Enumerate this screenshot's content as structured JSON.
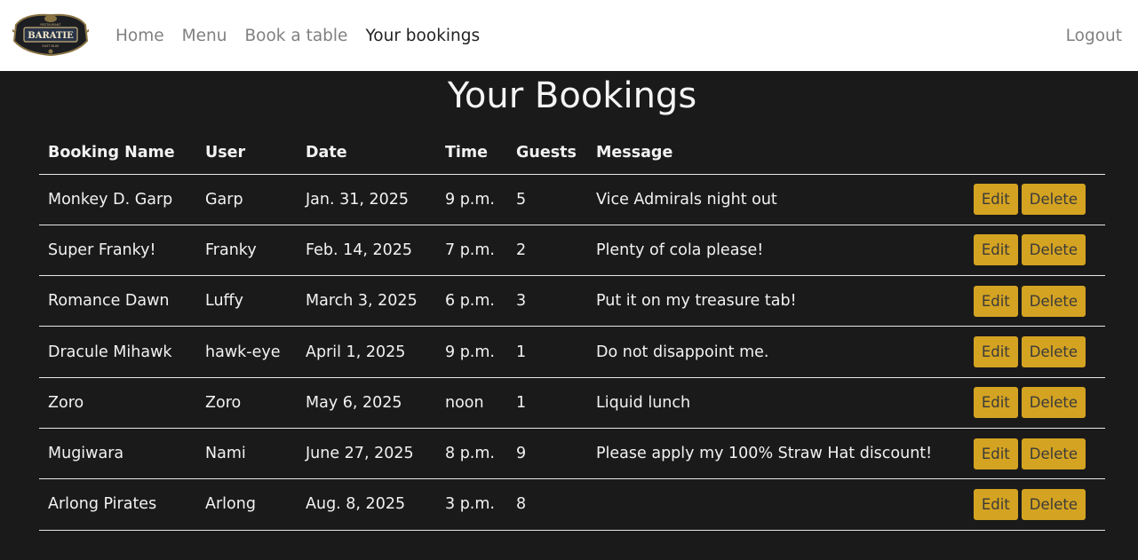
{
  "nav": {
    "items": [
      {
        "label": "Home",
        "active": false
      },
      {
        "label": "Menu",
        "active": false
      },
      {
        "label": "Book a table",
        "active": false
      },
      {
        "label": "Your bookings",
        "active": true
      }
    ],
    "logout_label": "Logout",
    "logo_icon": "baratie-logo-icon"
  },
  "page": {
    "title": "Your Bookings"
  },
  "table": {
    "columns": [
      "Booking Name",
      "User",
      "Date",
      "Time",
      "Guests",
      "Message",
      ""
    ],
    "rows": [
      {
        "name": "Monkey D. Garp",
        "user": "Garp",
        "date": "Jan. 31, 2025",
        "time": "9 p.m.",
        "guests": "5",
        "message": "Vice Admirals night out"
      },
      {
        "name": "Super Franky!",
        "user": "Franky",
        "date": "Feb. 14, 2025",
        "time": "7 p.m.",
        "guests": "2",
        "message": "Plenty of cola please!"
      },
      {
        "name": "Romance Dawn",
        "user": "Luffy",
        "date": "March 3, 2025",
        "time": "6 p.m.",
        "guests": "3",
        "message": "Put it on my treasure tab!"
      },
      {
        "name": "Dracule Mihawk",
        "user": "hawk-eye",
        "date": "April 1, 2025",
        "time": "9 p.m.",
        "guests": "1",
        "message": "Do not disappoint me."
      },
      {
        "name": "Zoro",
        "user": "Zoro",
        "date": "May 6, 2025",
        "time": "noon",
        "guests": "1",
        "message": "Liquid lunch"
      },
      {
        "name": "Mugiwara",
        "user": "Nami",
        "date": "June 27, 2025",
        "time": "8 p.m.",
        "guests": "9",
        "message": "Please apply my 100% Straw Hat discount!"
      },
      {
        "name": "Arlong Pirates",
        "user": "Arlong",
        "date": "Aug. 8, 2025",
        "time": "3 p.m.",
        "guests": "8",
        "message": ""
      }
    ],
    "edit_label": "Edit",
    "delete_label": "Delete"
  },
  "colors": {
    "background": "#1a1a1a",
    "navbar": "#ffffff",
    "button": "#d4a321"
  }
}
